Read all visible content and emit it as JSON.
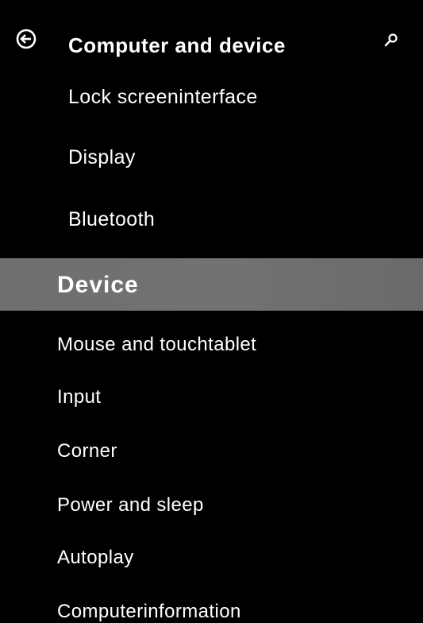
{
  "header": {
    "back_icon": "arrow-left-circle-icon",
    "title": "Computer and device",
    "search_icon": "search-icon"
  },
  "subsection_items": [
    {
      "label": "Lock screeninterface"
    },
    {
      "label": "Display"
    },
    {
      "label": "Bluetooth"
    }
  ],
  "section": {
    "label": "Device",
    "highlight_color": "#707070"
  },
  "section_items": [
    {
      "label": "Mouse and touchtablet"
    },
    {
      "label": "Input"
    },
    {
      "label": "Corner"
    },
    {
      "label": "Power and sleep"
    },
    {
      "label": "Autoplay"
    },
    {
      "label": "Computerinformation"
    }
  ],
  "colors": {
    "background": "#000000",
    "text": "#ffffff"
  }
}
